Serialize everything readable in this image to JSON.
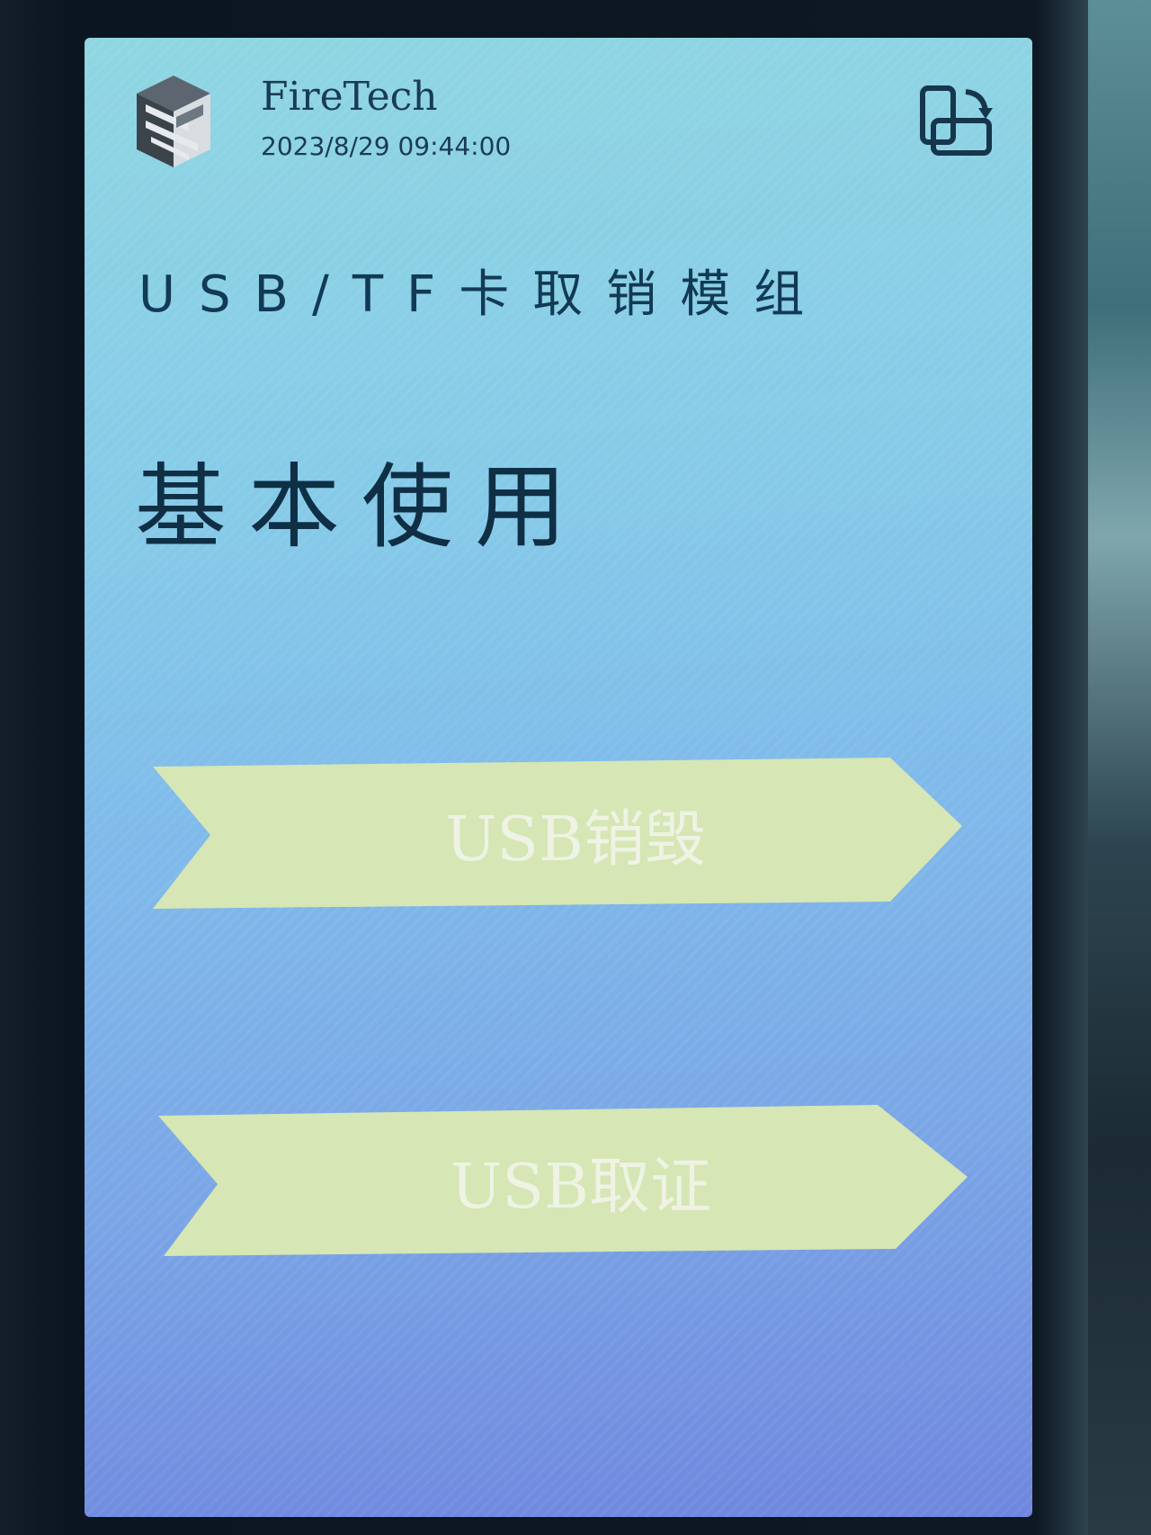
{
  "header": {
    "brand_name": "FireTech",
    "datetime": "2023/8/29 09:44:00",
    "logo_icon": "cube-s-logo-icon",
    "switch_icon": "screen-rotate-icon"
  },
  "main": {
    "subtitle": "USB/TF卡取销模组",
    "page_title": "基本使用",
    "buttons": [
      {
        "label": "USB销毁"
      },
      {
        "label": "USB取证"
      }
    ]
  },
  "colors": {
    "banner_fill": "#d6e6b4",
    "text_dark": "#123a55",
    "banner_text": "#eef3e4"
  }
}
